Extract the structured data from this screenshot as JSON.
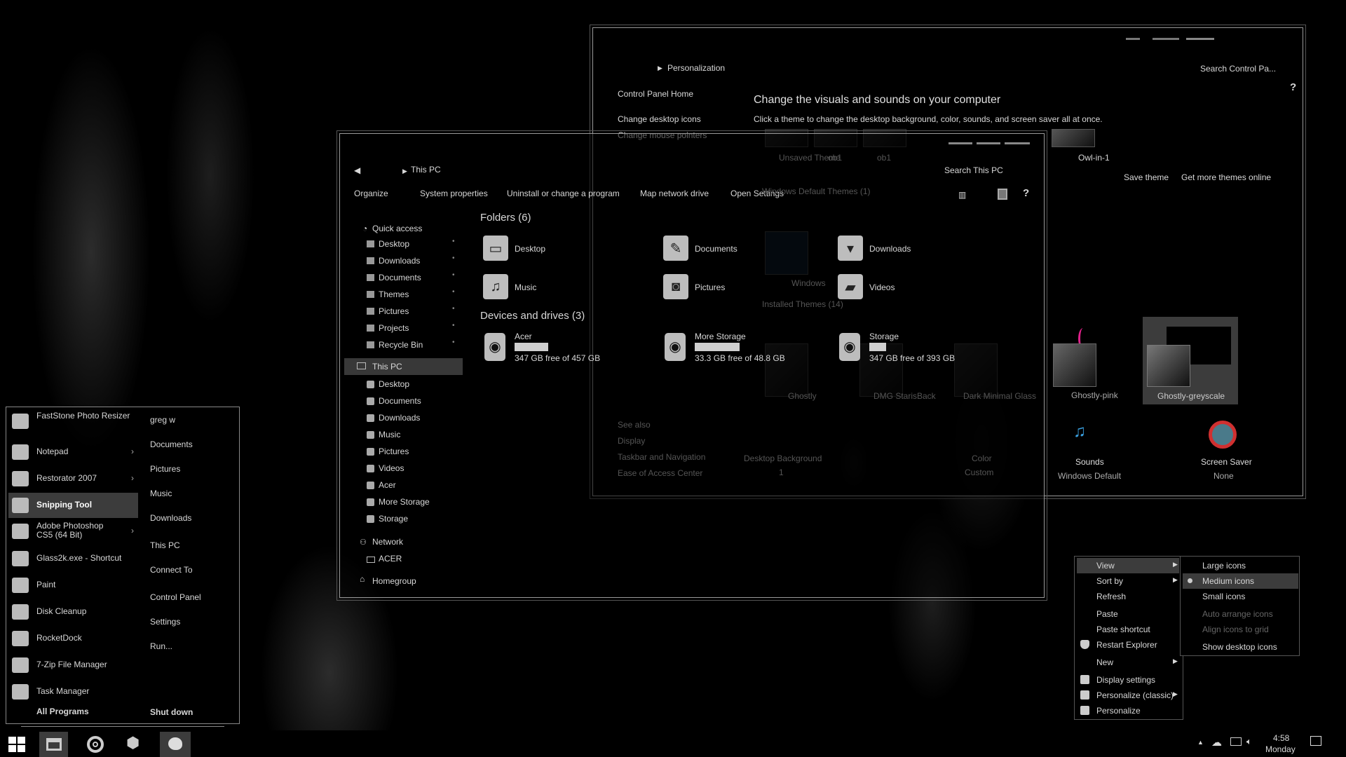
{
  "control_panel": {
    "breadcrumb": "Personalization",
    "search_placeholder": "Search Control Pa...",
    "help": "?",
    "sidebar": [
      "Control Panel Home",
      "Change desktop icons",
      "Change mouse pointers"
    ],
    "title": "Change the visuals and sounds on your computer",
    "subtitle": "Click a theme to change the desktop background, color, sounds, and screen saver all at once.",
    "my_themes": [
      "Unsaved Theme",
      "ob1",
      "ob1",
      "Owl-in-1"
    ],
    "save_theme": "Save theme",
    "get_more": "Get more themes online",
    "default_header": "Windows Default Themes (1)",
    "default_theme": "Windows",
    "installed_header": "Installed Themes (14)",
    "installed": [
      "Ghostly",
      "DMG StarisBack",
      "Dark Minimal Glass",
      "Ghostly-pink",
      "Ghostly-greyscale"
    ],
    "selected_theme": "Ghostly-greyscale",
    "see_also": {
      "label": "See also",
      "links": [
        "Display",
        "Taskbar and Navigation",
        "Ease of Access Center"
      ]
    },
    "settings": [
      {
        "label": "Desktop Background",
        "value": "1"
      },
      {
        "label": "Color",
        "value": "Custom"
      },
      {
        "label": "Sounds",
        "value": "Windows Default"
      },
      {
        "label": "Screen Saver",
        "value": "None"
      }
    ],
    "accent_pink": "#e0208a"
  },
  "explorer": {
    "breadcrumb": "This PC",
    "search_placeholder": "Search This PC",
    "toolbar": [
      "Organize",
      "System properties",
      "Uninstall or change a program",
      "Map network drive",
      "Open Settings"
    ],
    "help": "?",
    "nav": {
      "quick_access": "Quick access",
      "quick_items": [
        "Desktop",
        "Downloads",
        "Documents",
        "Themes",
        "Pictures",
        "Projects",
        "Recycle Bin"
      ],
      "this_pc": "This PC",
      "pc_items": [
        "Desktop",
        "Documents",
        "Downloads",
        "Music",
        "Pictures",
        "Videos",
        "Acer",
        "More Storage",
        "Storage"
      ],
      "network": "Network",
      "network_items": [
        "ACER"
      ],
      "homegroup": "Homegroup"
    },
    "folders_header": "Folders (6)",
    "folders": [
      {
        "name": "Desktop",
        "icon": "desktop-icon"
      },
      {
        "name": "Documents",
        "icon": "documents-icon"
      },
      {
        "name": "Downloads",
        "icon": "downloads-icon"
      },
      {
        "name": "Music",
        "icon": "music-icon"
      },
      {
        "name": "Pictures",
        "icon": "camera-icon"
      },
      {
        "name": "Videos",
        "icon": "clapper-icon"
      }
    ],
    "drives_header": "Devices and drives (3)",
    "drives": [
      {
        "name": "Acer",
        "free": "347 GB free of 457 GB",
        "used_fraction": 0.24
      },
      {
        "name": "More Storage",
        "free": "33.3 GB free of 48.8 GB",
        "used_fraction": 0.32
      },
      {
        "name": "Storage",
        "free": "347 GB free of 393 GB",
        "used_fraction": 0.12
      }
    ]
  },
  "start_menu": {
    "programs": [
      {
        "label": "FastStone Photo Resizer",
        "icon": "camera-icon",
        "arrow": false
      },
      {
        "label": "Notepad",
        "icon": "notepad-icon",
        "arrow": true
      },
      {
        "label": "Restorator 2007",
        "icon": "restorator-icon",
        "arrow": true
      },
      {
        "label": "Snipping Tool",
        "icon": "snipping-icon",
        "arrow": false,
        "selected": true
      },
      {
        "label": "Adobe Photoshop CS5 (64 Bit)",
        "icon": "photoshop-icon",
        "arrow": true
      },
      {
        "label": "Glass2k.exe - Shortcut",
        "icon": "window-icon",
        "arrow": false
      },
      {
        "label": "Paint",
        "icon": "paint-icon",
        "arrow": false
      },
      {
        "label": "Disk Cleanup",
        "icon": "disk-cleanup-icon",
        "arrow": false
      },
      {
        "label": "RocketDock",
        "icon": "rocketdock-icon",
        "arrow": false
      },
      {
        "label": "7-Zip File Manager",
        "icon": "zip-icon",
        "arrow": false
      },
      {
        "label": "Task Manager",
        "icon": "task-manager-icon",
        "arrow": false
      }
    ],
    "all_programs": "All Programs",
    "places": [
      "greg w",
      "Documents",
      "Pictures",
      "Music",
      "Downloads",
      "This PC",
      "Connect To",
      "Control Panel",
      "Settings",
      "Run..."
    ],
    "shutdown": "Shut down"
  },
  "context_menu": {
    "items": [
      {
        "label": "View",
        "arrow": true,
        "highlighted": true
      },
      {
        "label": "Sort by",
        "arrow": true
      },
      {
        "label": "Refresh"
      },
      {
        "label": "Paste"
      },
      {
        "label": "Paste shortcut"
      },
      {
        "label": "Restart Explorer",
        "icon": "shield-icon"
      },
      {
        "label": "New",
        "arrow": true
      },
      {
        "label": "Display settings",
        "icon": "monitor-icon"
      },
      {
        "label": "Personalize (classic)",
        "icon": "personalize-icon",
        "arrow": true
      },
      {
        "label": "Personalize",
        "icon": "personalize-icon"
      }
    ],
    "submenu": [
      {
        "label": "Large icons"
      },
      {
        "label": "Medium icons",
        "checked": true
      },
      {
        "label": "Small icons"
      },
      {
        "label": "Auto arrange icons",
        "disabled": true
      },
      {
        "label": "Align icons to grid",
        "disabled": true
      },
      {
        "label": "Show desktop icons"
      }
    ]
  },
  "taskbar": {
    "buttons": [
      "start-icon",
      "file-explorer-icon",
      "chrome-icon",
      "hexagons-icon",
      "personalize-icon"
    ],
    "time": "4:58",
    "day": "Monday",
    "tray": [
      "show-hidden-icon",
      "onedrive-icon",
      "network-icon",
      "volume-icon",
      "notifications-icon"
    ]
  }
}
